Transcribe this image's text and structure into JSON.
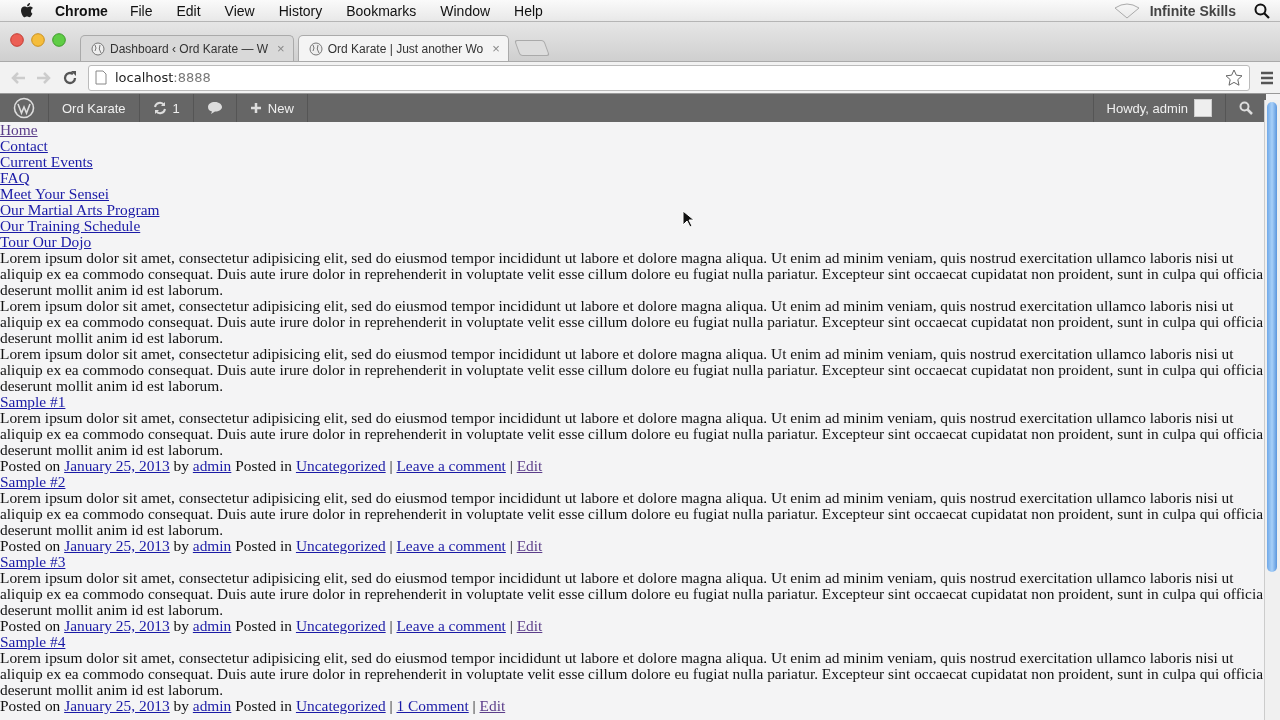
{
  "menubar": {
    "app": "Chrome",
    "items": [
      "File",
      "Edit",
      "View",
      "History",
      "Bookmarks",
      "Window",
      "Help"
    ],
    "right_label": "Infinite Skills"
  },
  "tabs": [
    {
      "title": "Dashboard ‹ Ord Karate — W",
      "close": "×",
      "selected": false
    },
    {
      "title": "Ord Karate | Just another Wo",
      "close": "×",
      "selected": true
    }
  ],
  "address": {
    "host": "localhost",
    "port": ":8888"
  },
  "admin_bar": {
    "site": "Ord Karate",
    "updates": "1",
    "new": "New",
    "howdy": "Howdy, admin"
  },
  "nav": [
    {
      "label": "Home",
      "visited": true
    },
    {
      "label": "Contact",
      "visited": false
    },
    {
      "label": "Current Events",
      "visited": false
    },
    {
      "label": "FAQ",
      "visited": false
    },
    {
      "label": "Meet Your Sensei",
      "visited": false
    },
    {
      "label": "Our Martial Arts Program",
      "visited": false
    },
    {
      "label": "Our Training Schedule",
      "visited": false
    },
    {
      "label": "Tour Our Dojo",
      "visited": false
    }
  ],
  "paragraphs": [
    "Lorem ipsum dolor sit amet, consectetur adipisicing elit, sed do eiusmod tempor incididunt ut labore et dolore magna aliqua. Ut enim ad minim veniam, quis nostrud exercitation ullamco laboris nisi ut aliquip ex ea commodo consequat. Duis aute irure dolor in reprehenderit in voluptate velit esse cillum dolore eu fugiat nulla pariatur. Excepteur sint occaecat cupidatat non proident, sunt in culpa qui officia deserunt mollit anim id est laborum.",
    "Lorem ipsum dolor sit amet, consectetur adipisicing elit, sed do eiusmod tempor incididunt ut labore et dolore magna aliqua. Ut enim ad minim veniam, quis nostrud exercitation ullamco laboris nisi ut aliquip ex ea commodo consequat. Duis aute irure dolor in reprehenderit in voluptate velit esse cillum dolore eu fugiat nulla pariatur. Excepteur sint occaecat cupidatat non proident, sunt in culpa qui officia deserunt mollit anim id est laborum.",
    "Lorem ipsum dolor sit amet, consectetur adipisicing elit, sed do eiusmod tempor incididunt ut labore et dolore magna aliqua. Ut enim ad minim veniam, quis nostrud exercitation ullamco laboris nisi ut aliquip ex ea commodo consequat. Duis aute irure dolor in reprehenderit in voluptate velit esse cillum dolore eu fugiat nulla pariatur. Excepteur sint occaecat cupidatat non proident, sunt in culpa qui officia deserunt mollit anim id est laborum."
  ],
  "posts": [
    {
      "title": "Sample #1",
      "body": "Lorem ipsum dolor sit amet, consectetur adipisicing elit, sed do eiusmod tempor incididunt ut labore et dolore magna aliqua. Ut enim ad minim veniam, quis nostrud exercitation ullamco laboris nisi ut aliquip ex ea commodo consequat. Duis aute irure dolor in reprehenderit in voluptate velit esse cillum dolore eu fugiat nulla pariatur. Excepteur sint occaecat cupidatat non proident, sunt in culpa qui officia deserunt mollit anim id est laborum.",
      "meta": [
        {
          "kind": "text",
          "text": "Posted on"
        },
        {
          "kind": "link",
          "text": "January 25, 2013",
          "visited": false
        },
        {
          "kind": "text",
          "text": "by"
        },
        {
          "kind": "link",
          "text": "admin",
          "visited": false
        },
        {
          "kind": "text",
          "text": "Posted in"
        },
        {
          "kind": "link",
          "text": "Uncategorized",
          "visited": false
        },
        {
          "kind": "text",
          "text": "|"
        },
        {
          "kind": "link",
          "text": "Leave a comment",
          "visited": false
        },
        {
          "kind": "text",
          "text": "|"
        },
        {
          "kind": "link",
          "text": "Edit",
          "visited": true
        }
      ]
    },
    {
      "title": "Sample #2",
      "body": "Lorem ipsum dolor sit amet, consectetur adipisicing elit, sed do eiusmod tempor incididunt ut labore et dolore magna aliqua. Ut enim ad minim veniam, quis nostrud exercitation ullamco laboris nisi ut aliquip ex ea commodo consequat. Duis aute irure dolor in reprehenderit in voluptate velit esse cillum dolore eu fugiat nulla pariatur. Excepteur sint occaecat cupidatat non proident, sunt in culpa qui officia deserunt mollit anim id est laborum.",
      "meta": [
        {
          "kind": "text",
          "text": "Posted on"
        },
        {
          "kind": "link",
          "text": "January 25, 2013",
          "visited": false
        },
        {
          "kind": "text",
          "text": "by"
        },
        {
          "kind": "link",
          "text": "admin",
          "visited": false
        },
        {
          "kind": "text",
          "text": "Posted in"
        },
        {
          "kind": "link",
          "text": "Uncategorized",
          "visited": false
        },
        {
          "kind": "text",
          "text": "|"
        },
        {
          "kind": "link",
          "text": "Leave a comment",
          "visited": false
        },
        {
          "kind": "text",
          "text": "|"
        },
        {
          "kind": "link",
          "text": "Edit",
          "visited": true
        }
      ]
    },
    {
      "title": "Sample #3",
      "body": "Lorem ipsum dolor sit amet, consectetur adipisicing elit, sed do eiusmod tempor incididunt ut labore et dolore magna aliqua. Ut enim ad minim veniam, quis nostrud exercitation ullamco laboris nisi ut aliquip ex ea commodo consequat. Duis aute irure dolor in reprehenderit in voluptate velit esse cillum dolore eu fugiat nulla pariatur. Excepteur sint occaecat cupidatat non proident, sunt in culpa qui officia deserunt mollit anim id est laborum.",
      "meta": [
        {
          "kind": "text",
          "text": "Posted on"
        },
        {
          "kind": "link",
          "text": "January 25, 2013",
          "visited": false
        },
        {
          "kind": "text",
          "text": "by"
        },
        {
          "kind": "link",
          "text": "admin",
          "visited": false
        },
        {
          "kind": "text",
          "text": "Posted in"
        },
        {
          "kind": "link",
          "text": "Uncategorized",
          "visited": false
        },
        {
          "kind": "text",
          "text": "|"
        },
        {
          "kind": "link",
          "text": "Leave a comment",
          "visited": false
        },
        {
          "kind": "text",
          "text": "|"
        },
        {
          "kind": "link",
          "text": "Edit",
          "visited": true
        }
      ]
    },
    {
      "title": "Sample #4",
      "body": "Lorem ipsum dolor sit amet, consectetur adipisicing elit, sed do eiusmod tempor incididunt ut labore et dolore magna aliqua. Ut enim ad minim veniam, quis nostrud exercitation ullamco laboris nisi ut aliquip ex ea commodo consequat. Duis aute irure dolor in reprehenderit in voluptate velit esse cillum dolore eu fugiat nulla pariatur. Excepteur sint occaecat cupidatat non proident, sunt in culpa qui officia deserunt mollit anim id est laborum.",
      "meta": [
        {
          "kind": "text",
          "text": "Posted on"
        },
        {
          "kind": "link",
          "text": "January 25, 2013",
          "visited": false
        },
        {
          "kind": "text",
          "text": "by"
        },
        {
          "kind": "link",
          "text": "admin",
          "visited": false
        },
        {
          "kind": "text",
          "text": "Posted in"
        },
        {
          "kind": "link",
          "text": "Uncategorized",
          "visited": false
        },
        {
          "kind": "text",
          "text": "|"
        },
        {
          "kind": "link",
          "text": "1 Comment",
          "visited": false
        },
        {
          "kind": "text",
          "text": "|"
        },
        {
          "kind": "link",
          "text": "Edit",
          "visited": true
        }
      ]
    }
  ]
}
